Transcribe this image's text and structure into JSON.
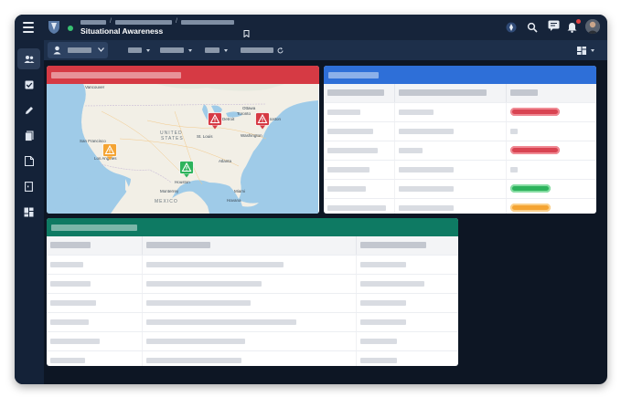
{
  "app": {
    "title": "Situational Awareness",
    "breadcrumb_placeholders": 3,
    "colors": {
      "red_header": "#d63a44",
      "blue_header": "#2e6fd8",
      "teal_header": "#0e7a63",
      "status_online": "#38c172"
    }
  },
  "topbar_icons": [
    "menu-icon",
    "app-logo-icon",
    "bookmark-icon",
    "compass-icon",
    "search-icon",
    "message-icon",
    "bell-icon"
  ],
  "sidebar": {
    "items": [
      {
        "name": "users-icon",
        "active": true
      },
      {
        "name": "checkbox-icon",
        "active": false
      },
      {
        "name": "pencil-icon",
        "active": false
      },
      {
        "name": "documents-icon",
        "active": false
      },
      {
        "name": "report-icon",
        "active": false
      },
      {
        "name": "door-icon",
        "active": false
      },
      {
        "name": "dashboard-icon",
        "active": false
      }
    ]
  },
  "map": {
    "labels": {
      "vancouver": "Vancouver",
      "ottawa": "Ottawa",
      "toronto": "Toronto",
      "detroit": "Detroit",
      "boston": "Boston",
      "united_states": "UNITED",
      "states": "STATES",
      "st_louis": "St. Louis",
      "washington": "Washington",
      "san_francisco": "San Francisco",
      "los_angeles": "Los Angeles",
      "atlanta": "Atlanta",
      "houston": "Houston",
      "monterrey": "Monterrey",
      "miami": "Miami",
      "mexico": "MEXICO",
      "havana": "Havana"
    },
    "markers": [
      {
        "status": "red",
        "near": "Detroit"
      },
      {
        "status": "red",
        "near": "Boston"
      },
      {
        "status": "orange",
        "near": "Los Angeles"
      },
      {
        "status": "green",
        "near": "Houston"
      }
    ]
  },
  "status_table": {
    "rows": [
      {
        "status": "red"
      },
      {
        "status": "none"
      },
      {
        "status": "red"
      },
      {
        "status": "none"
      },
      {
        "status": "green"
      },
      {
        "status": "orange"
      }
    ]
  },
  "bottom_table": {
    "row_count": 6
  }
}
